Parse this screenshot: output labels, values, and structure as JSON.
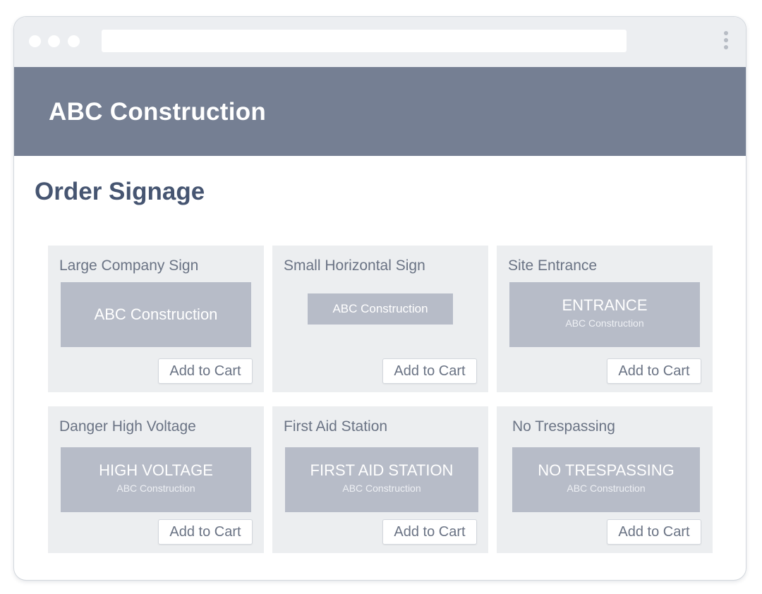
{
  "browser": {
    "url": "",
    "menu_icon": "kebab-menu-icon",
    "window_controls": [
      "window-dot-icon",
      "window-dot-icon",
      "window-dot-icon"
    ]
  },
  "header": {
    "brand": "ABC Construction",
    "background_color": "#757f93"
  },
  "main": {
    "title": "Order Signage",
    "add_to_cart_label": "Add to Cart",
    "products": [
      {
        "title": "Large Company Sign",
        "sign_text": "ABC Construction",
        "sign_subtext": ""
      },
      {
        "title": "Small Horizontal Sign",
        "sign_text": "ABC Construction",
        "sign_subtext": ""
      },
      {
        "title": "Site Entrance",
        "sign_text": "ENTRANCE",
        "sign_subtext": "ABC Construction"
      },
      {
        "title": "Danger High Voltage",
        "sign_text": "HIGH VOLTAGE",
        "sign_subtext": "ABC Construction"
      },
      {
        "title": "First Aid Station",
        "sign_text": "FIRST AID STATION",
        "sign_subtext": "ABC Construction"
      },
      {
        "title": "No Trespassing",
        "sign_text": "NO TRESPASSING",
        "sign_subtext": "ABC Construction"
      }
    ]
  },
  "colors": {
    "sign_fill": "#b7bcc8",
    "card_bg": "#eceef0",
    "title_text": "#465571"
  }
}
